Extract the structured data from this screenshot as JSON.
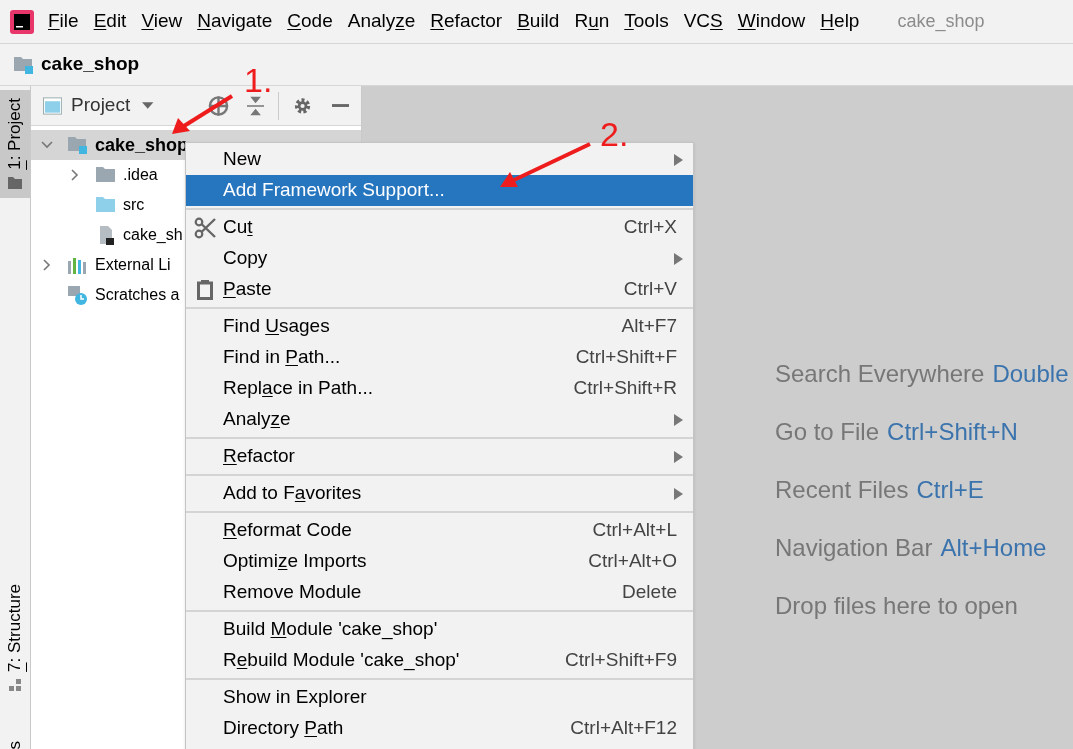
{
  "menu_bar": {
    "items": [
      {
        "key": "F",
        "post": "ile"
      },
      {
        "key": "E",
        "post": "dit"
      },
      {
        "key": "V",
        "post": "iew"
      },
      {
        "key": "N",
        "post": "avigate"
      },
      {
        "key": "C",
        "post": "ode"
      },
      {
        "pre": "Analy",
        "key": "z",
        "post": "e"
      },
      {
        "key": "R",
        "post": "efactor"
      },
      {
        "key": "B",
        "post": "uild"
      },
      {
        "pre": "R",
        "key": "u",
        "post": "n"
      },
      {
        "key": "T",
        "post": "ools"
      },
      {
        "pre": "VC",
        "key": "S"
      },
      {
        "key": "W",
        "post": "indow"
      },
      {
        "key": "H",
        "post": "elp"
      }
    ],
    "project_title": "cake_shop"
  },
  "nav_bar": {
    "crumb": "cake_shop"
  },
  "tool_stripe": [
    {
      "label": {
        "key": "1",
        "post": ": Project"
      },
      "selected": true
    },
    {
      "label": {
        "key": "7",
        "post": ": Structure"
      },
      "selected": false
    },
    {
      "label": "s",
      "selected": false
    }
  ],
  "project_panel": {
    "title": "Project",
    "tree": [
      {
        "label": "cake_shop",
        "kind": "module",
        "expanded": true,
        "selected": true,
        "children": [
          {
            "label": ".idea",
            "kind": "folder",
            "expanded": false
          },
          {
            "label": "src",
            "kind": "source"
          },
          {
            "label": "cake_sh",
            "kind": "file"
          }
        ]
      },
      {
        "label": "External Li",
        "kind": "libraries",
        "expanded": false
      },
      {
        "label": "Scratches a",
        "kind": "scratches"
      }
    ]
  },
  "editor_hints": [
    {
      "text": "Search Everywhere",
      "shortcut": "Double"
    },
    {
      "text": "Go to File",
      "shortcut": "Ctrl+Shift+N"
    },
    {
      "text": "Recent Files",
      "shortcut": "Ctrl+E"
    },
    {
      "text": "Navigation Bar",
      "shortcut": "Alt+Home"
    },
    {
      "text": "Drop files here to open"
    }
  ],
  "context_menu": [
    [
      {
        "label": "New",
        "kind": "submenu",
        "selected": false
      },
      {
        "label": "Add Framework Support...",
        "kind": "plain",
        "selected": true
      }
    ],
    [
      {
        "label": {
          "pre": "Cu",
          "key": "t"
        },
        "shortcut": "Ctrl+X",
        "kind": "cut",
        "selected": false
      },
      {
        "label": "Copy",
        "kind": "submenu",
        "selected": false
      },
      {
        "label": {
          "key": "P",
          "post": "aste"
        },
        "shortcut": "Ctrl+V",
        "kind": "paste",
        "selected": false
      }
    ],
    [
      {
        "label": {
          "pre": "Find ",
          "key": "U",
          "post": "sages"
        },
        "shortcut": "Alt+F7",
        "kind": "plain",
        "selected": false
      },
      {
        "label": {
          "pre": "Find in ",
          "key": "P",
          "post": "ath..."
        },
        "shortcut": "Ctrl+Shift+F",
        "kind": "plain",
        "selected": false
      },
      {
        "label": {
          "pre": "Repl",
          "key": "a",
          "post": "ce in Path..."
        },
        "shortcut": "Ctrl+Shift+R",
        "kind": "plain",
        "selected": false
      },
      {
        "label": {
          "pre": "Analy",
          "key": "z",
          "post": "e"
        },
        "kind": "submenu",
        "selected": false
      }
    ],
    [
      {
        "label": {
          "key": "R",
          "post": "efactor"
        },
        "kind": "submenu",
        "selected": false
      }
    ],
    [
      {
        "label": {
          "pre": "Add to F",
          "key": "a",
          "post": "vorites"
        },
        "kind": "submenu",
        "selected": false
      }
    ],
    [
      {
        "label": {
          "key": "R",
          "post": "eformat Code"
        },
        "shortcut": "Ctrl+Alt+L",
        "kind": "plain",
        "selected": false
      },
      {
        "label": {
          "pre": "Optimi",
          "key": "z",
          "post": "e Imports"
        },
        "shortcut": "Ctrl+Alt+O",
        "kind": "plain",
        "selected": false
      },
      {
        "label": "Remove Module",
        "shortcut": "Delete",
        "kind": "plain",
        "selected": false
      }
    ],
    [
      {
        "label": {
          "pre": "Build ",
          "key": "M",
          "post": "odule 'cake_shop'"
        },
        "kind": "plain",
        "selected": false
      },
      {
        "label": {
          "pre": "R",
          "key": "e",
          "post": "build Module 'cake_shop'"
        },
        "shortcut": "Ctrl+Shift+F9",
        "kind": "plain",
        "selected": false
      }
    ],
    [
      {
        "label": "Show in Explorer",
        "kind": "plain",
        "selected": false
      },
      {
        "label": {
          "pre": "Directory ",
          "key": "P",
          "post": "ath"
        },
        "shortcut": "Ctrl+Alt+F12",
        "kind": "plain",
        "selected": false
      }
    ]
  ],
  "annotations": [
    "1.",
    "2."
  ]
}
